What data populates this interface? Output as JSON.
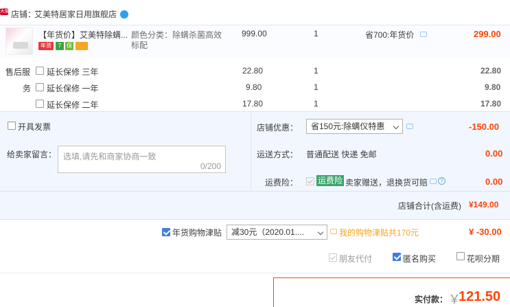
{
  "shop": {
    "label": "店铺：",
    "name": "艾美特居家日用旗舰店",
    "logo_text": "天猫"
  },
  "item": {
    "title": "【年货价】艾美特除螨...",
    "attr_label": "颜色分类：除螨杀菌高效",
    "attr_label2": "标配",
    "price": "999.00",
    "qty": "1",
    "saving": "省700:年货价",
    "subtotal": "299.00",
    "badge_year": "年货",
    "badge_seven": "7",
    "badge_guarantee": "保"
  },
  "aftersale": {
    "label_line1": "售后服",
    "label_line2": "务",
    "rows": [
      {
        "label": "延长保修 三年",
        "price": "22.80",
        "qty": "1",
        "subtotal": "22.80"
      },
      {
        "label": "延长保修 一年",
        "price": "9.80",
        "qty": "1",
        "subtotal": "9.80"
      },
      {
        "label": "延长保修 二年",
        "price": "17.80",
        "qty": "1",
        "subtotal": "17.80"
      }
    ]
  },
  "options": {
    "invoice_label": "开具发票",
    "shop_discount_label": "店铺优惠：",
    "shop_discount_value": "省150元:除螨仪特惠",
    "shop_discount_amount": "-150.00",
    "message_label": "给卖家留言：",
    "message_placeholder": "选填,请先和商家协商一致",
    "message_counter": "0/200",
    "shipping_label": "运送方式：",
    "shipping_value": "普通配送 快递 免邮",
    "shipping_amount": "0.00",
    "insurance_label": "运费险：",
    "insurance_tag": "运费险",
    "insurance_text": "卖家赠送，退换货可赔",
    "insurance_amount": "0.00"
  },
  "subtotal": {
    "label": "店铺合计(含运费)",
    "amount": "¥149.00"
  },
  "subsidy": {
    "label": "年货购物津贴",
    "select_value": "减30元（2020.01....",
    "note": "我的购物津贴共170元",
    "amount": "¥ -30.00"
  },
  "payment_options": {
    "friend_pay": "朋友代付",
    "anonymous": "匿名购买",
    "huabei": "花呗分期"
  },
  "final": {
    "label": "实付款：",
    "currency": "￥",
    "amount": "121.50"
  },
  "colors": {
    "accent_red": "#ff4400",
    "checkbox_blue": "#3d7ee0",
    "section_bg": "#f2f7ff",
    "insurance_green": "#3aa36b"
  }
}
